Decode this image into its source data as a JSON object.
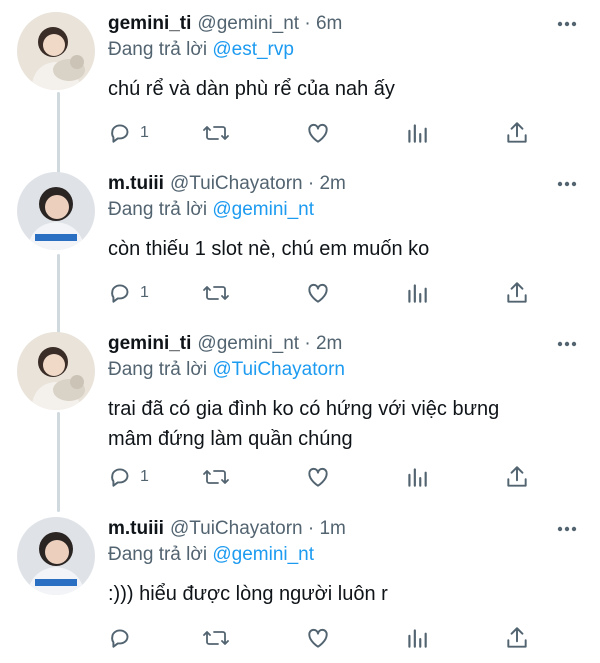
{
  "replying_label": "Đang trả lời",
  "tweets": [
    {
      "name": "gemini_ti",
      "handle": "@gemini_nt",
      "time": "· 6m",
      "reply_to": "@est_rvp",
      "text": [
        "chú rể và dàn phù rể của nah ấy"
      ],
      "reply_count": "1",
      "avatar": "girl-with-cat"
    },
    {
      "name": "m.tuiii",
      "handle": "@TuiChayatorn",
      "time": "· 2m",
      "reply_to": "@gemini_nt",
      "text": [
        "còn thiếu 1 slot nè, chú em muốn ko"
      ],
      "reply_count": "1",
      "avatar": "boy-blue-jersey"
    },
    {
      "name": "gemini_ti",
      "handle": "@gemini_nt",
      "time": "· 2m",
      "reply_to": "@TuiChayatorn",
      "text": [
        "trai đã có gia đình ko có hứng với việc bưng",
        "mâm đứng làm quần chúng"
      ],
      "reply_count": "1",
      "avatar": "girl-with-cat"
    },
    {
      "name": "m.tuiii",
      "handle": "@TuiChayatorn",
      "time": "· 1m",
      "reply_to": "@gemini_nt",
      "text": [
        ":))) hiểu được lòng người luôn r"
      ],
      "reply_count": "",
      "avatar": "boy-blue-jersey"
    }
  ],
  "colors": {
    "text": "#0f1419",
    "secondary": "#536471",
    "link": "#1d9bf0",
    "thread_line": "#cfd9de"
  }
}
